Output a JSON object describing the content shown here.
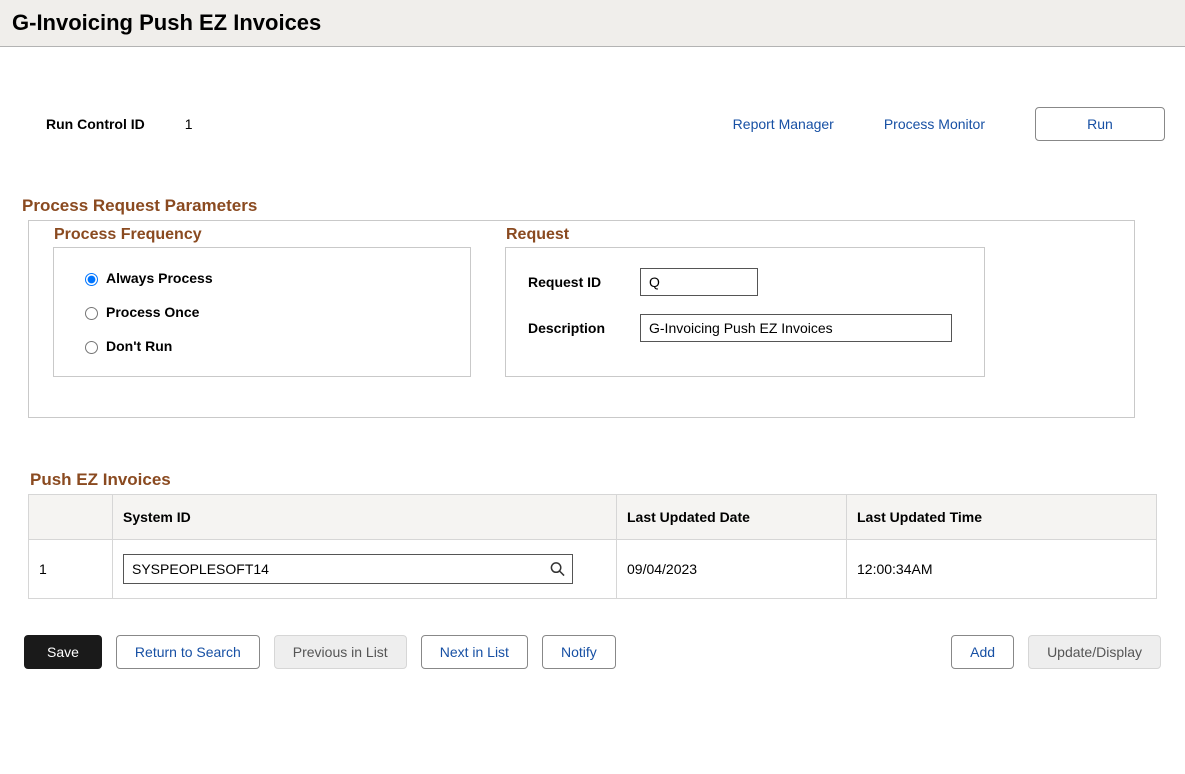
{
  "header": {
    "title": "G-Invoicing Push EZ Invoices"
  },
  "top": {
    "run_control_label": "Run Control ID",
    "run_control_value": "1",
    "report_manager": "Report Manager",
    "process_monitor": "Process Monitor",
    "run_button": "Run"
  },
  "section_params_title": "Process Request Parameters",
  "frequency": {
    "legend": "Process Frequency",
    "options": {
      "always": "Always Process",
      "once": "Process Once",
      "dont": "Don't Run"
    },
    "selected": "always"
  },
  "request": {
    "legend": "Request",
    "id_label": "Request ID",
    "id_value": "Q",
    "desc_label": "Description",
    "desc_value": "G-Invoicing Push EZ Invoices"
  },
  "table": {
    "title": "Push EZ Invoices",
    "columns": {
      "system_id": "System ID",
      "last_date": "Last Updated Date",
      "last_time": "Last Updated Time"
    },
    "rows": [
      {
        "num": "1",
        "system_id": "SYSPEOPLESOFT14",
        "last_date": "09/04/2023",
        "last_time": "12:00:34AM"
      }
    ]
  },
  "footer": {
    "save": "Save",
    "return_to_search": "Return to Search",
    "previous": "Previous in List",
    "next": "Next in List",
    "notify": "Notify",
    "add": "Add",
    "update_display": "Update/Display"
  }
}
